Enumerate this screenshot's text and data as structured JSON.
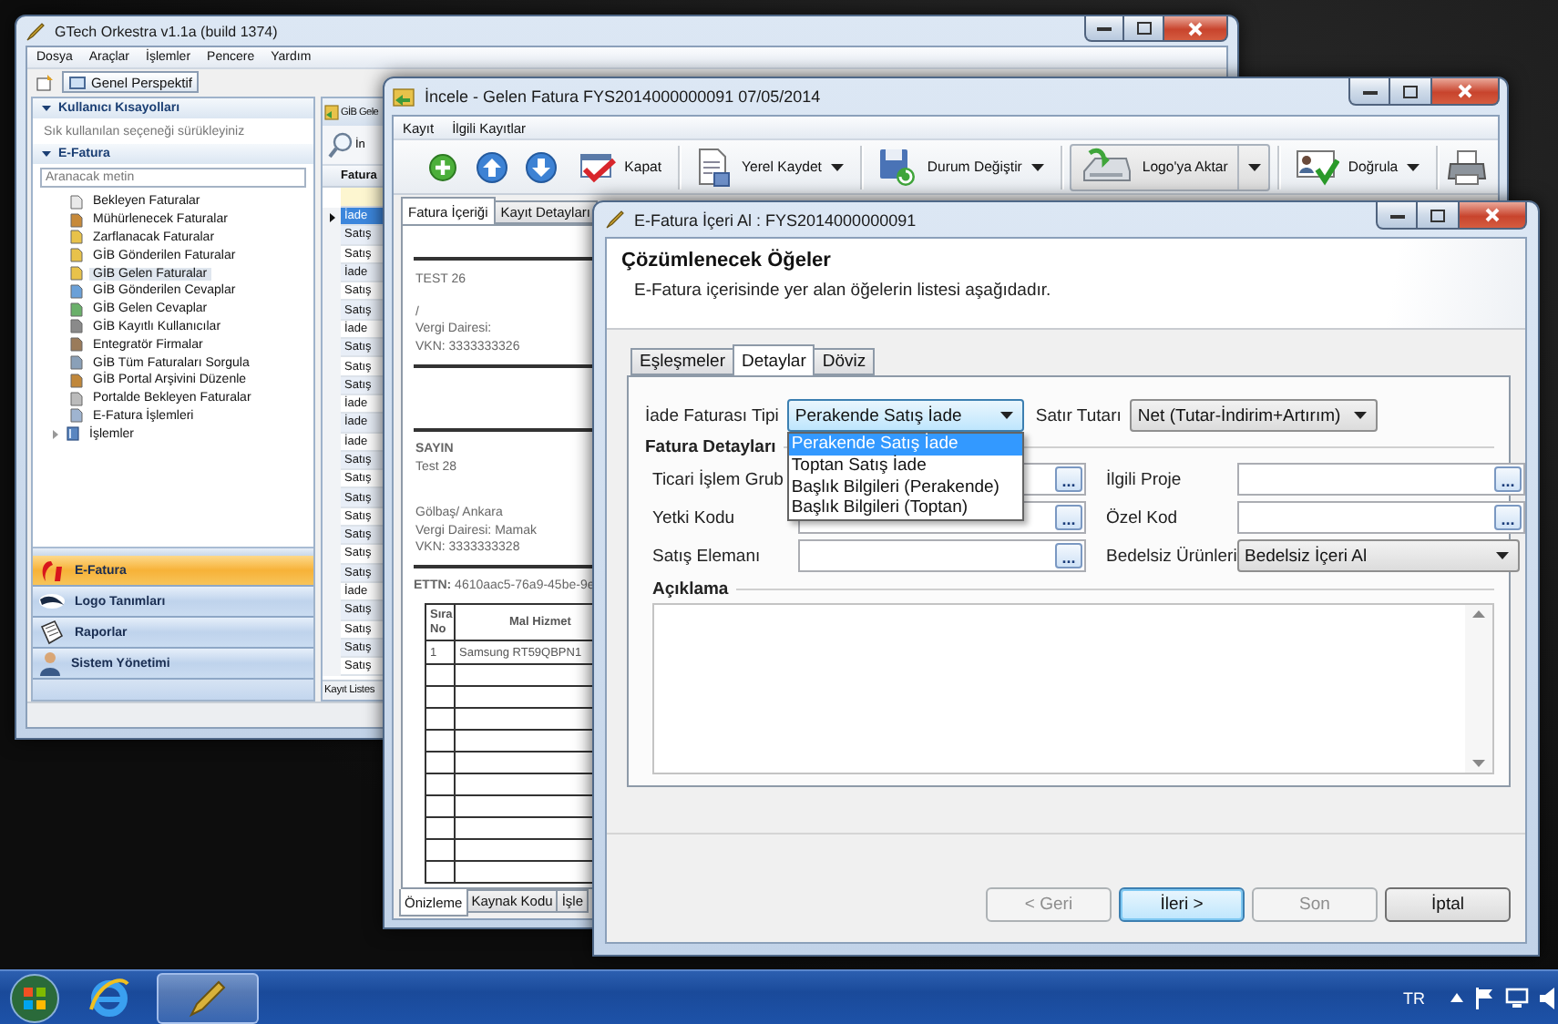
{
  "main_window": {
    "title": "GTech Orkestra v1.1a (build 1374)",
    "menu": [
      "Dosya",
      "Araçlar",
      "İşlemler",
      "Pencere",
      "Yardım"
    ],
    "perspective": "Genel Perspektif",
    "shortcuts": {
      "title": "Kullanıcı Kısayolları",
      "expanded": true,
      "hint": "Sık kullanılan seçeneği sürükleyiniz"
    },
    "efatura": {
      "title": "E-Fatura",
      "expanded": true,
      "search_placeholder": "Aranacak metin",
      "tree": [
        {
          "label": "Bekleyen Faturalar",
          "kind": "leaf",
          "selected": false
        },
        {
          "label": "Mühürlenecek Faturalar",
          "kind": "leaf",
          "selected": false
        },
        {
          "label": "Zarflanacak Faturalar",
          "kind": "leaf",
          "selected": false
        },
        {
          "label": "GİB Gönderilen Faturalar",
          "kind": "leaf",
          "selected": false
        },
        {
          "label": "GİB Gelen Faturalar",
          "kind": "leaf",
          "selected": true
        },
        {
          "label": "GİB Gönderilen Cevaplar",
          "kind": "leaf",
          "selected": false
        },
        {
          "label": "GİB Gelen Cevaplar",
          "kind": "leaf",
          "selected": false
        },
        {
          "label": "GİB Kayıtlı Kullanıcılar",
          "kind": "leaf",
          "selected": false
        },
        {
          "label": "Entegratör Firmalar",
          "kind": "leaf",
          "selected": false
        },
        {
          "label": "GİB Tüm Faturaları Sorgula",
          "kind": "leaf",
          "selected": false
        },
        {
          "label": "GİB Portal Arşivini Düzenle",
          "kind": "leaf",
          "selected": false
        },
        {
          "label": "Portalde Bekleyen Faturalar",
          "kind": "leaf",
          "selected": false
        },
        {
          "label": "E-Fatura İşlemleri",
          "kind": "leaf",
          "selected": false
        },
        {
          "label": "İşlemler",
          "kind": "group",
          "expanded": false,
          "selected": false
        }
      ]
    },
    "nav": [
      {
        "label": "E-Fatura",
        "selected": true
      },
      {
        "label": "Logo Tanımları",
        "selected": false
      },
      {
        "label": "Raporlar",
        "selected": false
      },
      {
        "label": "Sistem Yönetimi",
        "selected": false
      }
    ],
    "list": {
      "title": "GİB Gele",
      "toolbar_button": "İn",
      "column": "Fatura",
      "footer": "Kayıt Listes",
      "rows": [
        {
          "type": "İade",
          "selected": true
        },
        {
          "type": "Satış",
          "selected": false
        },
        {
          "type": "Satış",
          "selected": false
        },
        {
          "type": "İade",
          "selected": false
        },
        {
          "type": "Satış",
          "selected": false
        },
        {
          "type": "Satış",
          "selected": false
        },
        {
          "type": "İade",
          "selected": false
        },
        {
          "type": "Satış",
          "selected": false
        },
        {
          "type": "Satış",
          "selected": false
        },
        {
          "type": "Satış",
          "selected": false
        },
        {
          "type": "İade",
          "selected": false
        },
        {
          "type": "İade",
          "selected": false
        },
        {
          "type": "İade",
          "selected": false
        },
        {
          "type": "Satış",
          "selected": false
        },
        {
          "type": "Satış",
          "selected": false
        },
        {
          "type": "Satış",
          "selected": false
        },
        {
          "type": "Satış",
          "selected": false
        },
        {
          "type": "Satış",
          "selected": false
        },
        {
          "type": "Satış",
          "selected": false
        },
        {
          "type": "Satış",
          "selected": false
        },
        {
          "type": "İade",
          "selected": false
        },
        {
          "type": "Satış",
          "selected": false
        },
        {
          "type": "Satış",
          "selected": false
        },
        {
          "type": "Satış",
          "selected": false
        },
        {
          "type": "Satış",
          "selected": false
        }
      ]
    }
  },
  "viewer_window": {
    "title": "İncele - Gelen Fatura FYS2014000000091 07/05/2014",
    "menu": [
      "Kayıt",
      "İlgili Kayıtlar"
    ],
    "toolbar": [
      {
        "label": "Kapat",
        "dropdown": false,
        "pressed": false
      },
      {
        "label": "Yerel Kaydet",
        "dropdown": true,
        "pressed": false
      },
      {
        "label": "Durum Değiştir",
        "dropdown": true,
        "pressed": false
      },
      {
        "label": "Logo'ya Aktar",
        "dropdown": true,
        "pressed": true
      },
      {
        "label": "Doğrula",
        "dropdown": true,
        "pressed": false
      }
    ],
    "tabs": [
      {
        "label": "Fatura İçeriği",
        "selected": true
      },
      {
        "label": "Kayıt Detayları",
        "selected": false
      }
    ],
    "document": {
      "sender": [
        "TEST 26",
        "/",
        "Vergi Dairesi:",
        "VKN: 3333333326"
      ],
      "recipient_heading": "SAYIN",
      "recipient": [
        "Test 28"
      ],
      "address": [
        "Gölbaş/ Ankara",
        "Vergi Dairesi: Mamak",
        "VKN: 3333333328"
      ],
      "ettn": "**ETTN:** 4610aac5-76a9-45be-9e",
      "table": {
        "columns": [
          "Sıra No",
          "Mal Hizmet"
        ],
        "rows": [
          [
            "1",
            "Samsung RT59QBPN1"
          ]
        ]
      }
    },
    "bottom_tabs": [
      {
        "label": "Önizleme",
        "selected": true
      },
      {
        "label": "Kaynak Kodu",
        "selected": false
      },
      {
        "label": "İşle",
        "selected": false
      }
    ]
  },
  "dialog": {
    "title": "E-Fatura İçeri Al : FYS2014000000091",
    "heading": "Çözümlenecek Öğeler",
    "description": "E-Fatura içerisinde yer alan öğelerin listesi aşağıdadır.",
    "tabs": [
      {
        "label": "Eşleşmeler",
        "selected": false
      },
      {
        "label": "Detaylar",
        "selected": true
      },
      {
        "label": "Döviz",
        "selected": false
      }
    ],
    "return_type": {
      "label": "İade Faturası Tipi",
      "value": "Perakende Satış İade",
      "expanded": true,
      "options": [
        {
          "label": "Perakende Satış İade",
          "selected": true
        },
        {
          "label": "Toptan Satış İade",
          "selected": false
        },
        {
          "label": "Başlık Bilgileri (Perakende)",
          "selected": false
        },
        {
          "label": "Başlık Bilgileri (Toptan)",
          "selected": false
        }
      ]
    },
    "line_amount": {
      "label": "Satır Tutarı",
      "value": "Net (Tutar-İndirim+Artırım)",
      "expanded": false
    },
    "details_group": "Fatura Detayları",
    "fields": [
      {
        "label": "Ticari İşlem Grub",
        "kind": "lookup",
        "button": "..."
      },
      {
        "label": "İlgili Proje",
        "kind": "lookup",
        "button": "..."
      },
      {
        "label": "Yetki Kodu",
        "kind": "lookup",
        "button": "..."
      },
      {
        "label": "Özel Kod",
        "kind": "lookup",
        "button": "..."
      },
      {
        "label": "Satış Elemanı",
        "kind": "lookup",
        "button": "..."
      },
      {
        "label": "Bedelsiz Ürünleri",
        "kind": "combo",
        "value": "Bedelsiz İçeri Al"
      }
    ],
    "notes_group": "Açıklama",
    "buttons": [
      {
        "label": "< Geri",
        "disabled": true,
        "default": false
      },
      {
        "label": "İleri >",
        "disabled": false,
        "default": true
      },
      {
        "label": "Son",
        "disabled": true,
        "default": false
      },
      {
        "label": "İptal",
        "disabled": false,
        "default": false
      }
    ]
  },
  "taskbar": {
    "apps": [
      {
        "selected": false
      },
      {
        "selected": true
      }
    ],
    "language": "TR"
  }
}
